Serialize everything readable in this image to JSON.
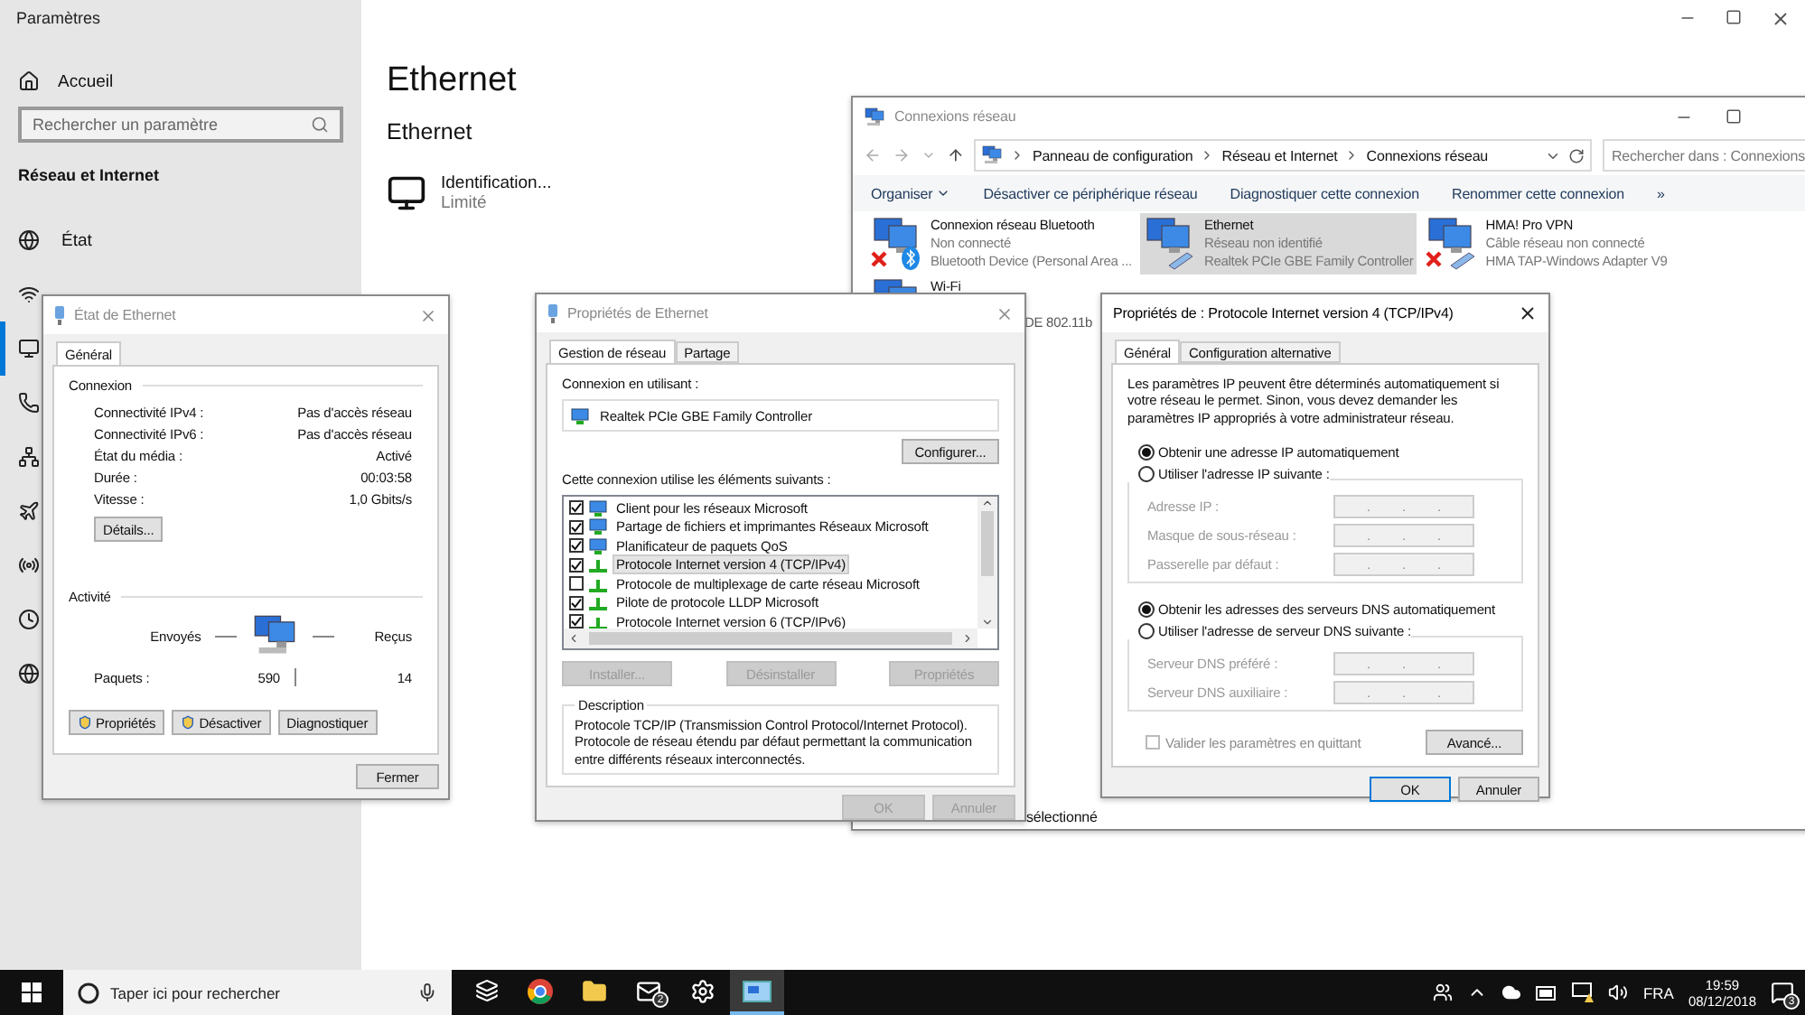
{
  "settings": {
    "title": "Paramètres",
    "home": "Accueil",
    "search_placeholder": "Rechercher un paramètre",
    "section": "Réseau et Internet",
    "nav": [
      {
        "kind": "status",
        "label": "État",
        "selected": false
      },
      {
        "kind": "wifi",
        "selected": false
      },
      {
        "kind": "ethernet",
        "selected": true
      },
      {
        "kind": "dialup",
        "selected": false
      },
      {
        "kind": "vpn",
        "selected": false
      },
      {
        "kind": "airplane",
        "selected": false
      },
      {
        "kind": "hotspot",
        "selected": false
      },
      {
        "kind": "data",
        "selected": false
      },
      {
        "kind": "proxy",
        "selected": false
      }
    ],
    "page_title": "Ethernet",
    "subtitle": "Ethernet",
    "connection": {
      "name": "Identification...",
      "status": "Limité"
    }
  },
  "network_connections": {
    "title": "Connexions réseau",
    "active": false,
    "breadcrumbs": [
      "Panneau de configuration",
      "Réseau et Internet",
      "Connexions réseau"
    ],
    "search_placeholder": "Rechercher dans : Connexions",
    "toolbar": [
      "Organiser",
      "Désactiver ce périphérique réseau",
      "Diagnostiquer cette connexion",
      "Renommer cette connexion"
    ],
    "more": "»",
    "adapters": [
      {
        "name": "Connexion réseau Bluetooth",
        "status": "Non connecté",
        "device": "Bluetooth Device (Personal Area ...",
        "selected": false,
        "disconnected": true,
        "kind": "bluetooth"
      },
      {
        "name": "Ethernet",
        "status": "Réseau non identifié",
        "device": "Realtek PCIe GBE Family Controller",
        "selected": true,
        "disconnected": false,
        "kind": "wired"
      },
      {
        "name": "HMA! Pro VPN",
        "status": "Câble réseau non connecté",
        "device": "HMA TAP-Windows Adapter V9",
        "selected": false,
        "disconnected": true,
        "kind": "wired"
      },
      {
        "name": "Wi-Fi",
        "device": "DE 802.11b",
        "selected": false,
        "kind": "wireless"
      }
    ],
    "status_text": "sélectionné"
  },
  "status_dialog": {
    "title": "État de Ethernet",
    "active": false,
    "tabs": [
      {
        "label": "Général",
        "selected": true
      }
    ],
    "connection_heading": "Connexion",
    "rows": [
      {
        "label": "Connectivité IPv4 :",
        "value": "Pas d'accès réseau"
      },
      {
        "label": "Connectivité IPv6 :",
        "value": "Pas d'accès réseau"
      },
      {
        "label": "État du média :",
        "value": "Activé"
      },
      {
        "label": "Durée :",
        "value": "00:03:58"
      },
      {
        "label": "Vitesse :",
        "value": "1,0 Gbits/s"
      }
    ],
    "details_button": "Détails...",
    "activity_heading": "Activité",
    "sent_label": "Envoyés",
    "received_label": "Reçus",
    "packets_label": "Paquets :",
    "packets_sent": "590",
    "packets_received": "14",
    "buttons": [
      {
        "label": "Propriétés",
        "shield": true
      },
      {
        "label": "Désactiver",
        "shield": true
      },
      {
        "label": "Diagnostiquer",
        "shield": false
      }
    ],
    "close_button": "Fermer"
  },
  "properties_dialog": {
    "title": "Propriétés de Ethernet",
    "active": false,
    "tabs": [
      {
        "label": "Gestion de réseau",
        "selected": true
      },
      {
        "label": "Partage",
        "selected": false
      }
    ],
    "connect_using_label": "Connexion en utilisant :",
    "adapter": "Realtek PCIe GBE Family Controller",
    "configure_button": "Configurer...",
    "items_label": "Cette connexion utilise les éléments suivants :",
    "items": [
      {
        "label": "Client pour les réseaux Microsoft",
        "checked": true,
        "kind": "client",
        "selected": false
      },
      {
        "label": "Partage de fichiers et imprimantes Réseaux Microsoft",
        "checked": true,
        "kind": "client",
        "selected": false
      },
      {
        "label": "Planificateur de paquets QoS",
        "checked": true,
        "kind": "client",
        "selected": false
      },
      {
        "label": "Protocole Internet version 4 (TCP/IPv4)",
        "checked": true,
        "kind": "protocol",
        "selected": true
      },
      {
        "label": "Protocole de multiplexage de carte réseau Microsoft",
        "checked": false,
        "kind": "protocol",
        "selected": false
      },
      {
        "label": "Pilote de protocole LLDP Microsoft",
        "checked": true,
        "kind": "protocol",
        "selected": false
      },
      {
        "label": "Protocole Internet version 6 (TCP/IPv6)",
        "checked": true,
        "kind": "protocol",
        "selected": false
      }
    ],
    "buttons": [
      {
        "label": "Installer...",
        "disabled": true
      },
      {
        "label": "Désinstaller",
        "disabled": true
      },
      {
        "label": "Propriétés",
        "disabled": true
      }
    ],
    "description_heading": "Description",
    "description": "Protocole TCP/IP (Transmission Control Protocol/Internet Protocol). Protocole de réseau étendu par défaut permettant la communication entre différents réseaux interconnectés.",
    "ok": {
      "label": "OK",
      "disabled": true
    },
    "cancel": {
      "label": "Annuler",
      "disabled": true
    }
  },
  "ipv4_dialog": {
    "title": "Propriétés de : Protocole Internet version 4 (TCP/IPv4)",
    "active": true,
    "tabs": [
      {
        "label": "Général",
        "selected": true
      },
      {
        "label": "Configuration alternative",
        "selected": false
      }
    ],
    "intro": "Les paramètres IP peuvent être déterminés automatiquement si votre réseau le permet. Sinon, vous devez demander les paramètres IP appropriés à votre administrateur réseau.",
    "ip_options": [
      {
        "label": "Obtenir une adresse IP automatiquement",
        "selected": true
      },
      {
        "label": "Utiliser l'adresse IP suivante :",
        "selected": false
      }
    ],
    "ip_fields": [
      {
        "label": "Adresse IP :",
        "dots": [
          ".",
          ".",
          "."
        ]
      },
      {
        "label": "Masque de sous-réseau :",
        "dots": [
          ".",
          ".",
          "."
        ]
      },
      {
        "label": "Passerelle par défaut :",
        "dots": [
          ".",
          ".",
          "."
        ]
      }
    ],
    "dns_options": [
      {
        "label": "Obtenir les adresses des serveurs DNS automatiquement",
        "selected": true
      },
      {
        "label": "Utiliser l'adresse de serveur DNS suivante :",
        "selected": false
      }
    ],
    "dns_fields": [
      {
        "label": "Serveur DNS préféré :",
        "dots": [
          ".",
          ".",
          "."
        ]
      },
      {
        "label": "Serveur DNS auxiliaire :",
        "dots": [
          ".",
          ".",
          "."
        ]
      }
    ],
    "validate": {
      "label": "Valider les paramètres en quittant",
      "checked": false
    },
    "advanced_button": "Avancé...",
    "ok": "OK",
    "cancel": "Annuler"
  },
  "taskbar": {
    "search_placeholder": "Taper ici pour rechercher",
    "apps": [
      {
        "kind": "taskview",
        "active": false
      },
      {
        "kind": "browser",
        "active": false
      },
      {
        "kind": "folder",
        "active": false
      },
      {
        "kind": "mail",
        "active": false,
        "badge": "2"
      },
      {
        "kind": "settings",
        "active": false
      },
      {
        "kind": "network",
        "active": true
      }
    ],
    "language": "FRA",
    "time": "19:59",
    "date": "08/12/2018",
    "notifications": "3"
  }
}
